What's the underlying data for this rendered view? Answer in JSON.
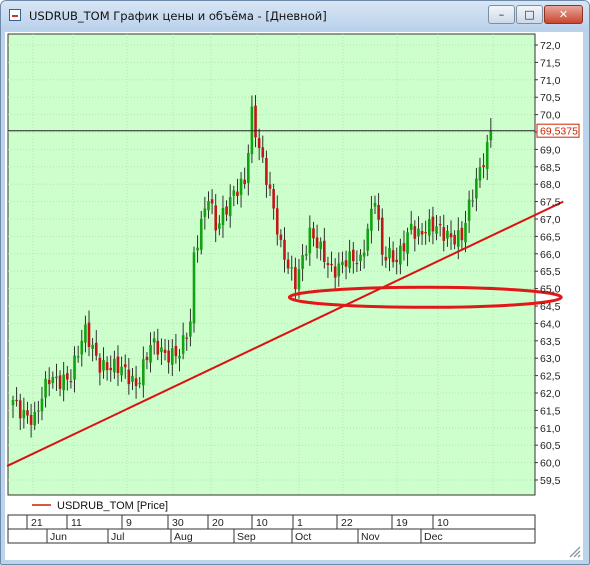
{
  "window": {
    "title": "USDRUB_TOM График цены и объёма - [Дневной]",
    "minimize_label": "–",
    "maximize_label": "□",
    "close_label": "✕",
    "icon": "app-icon"
  },
  "legend": {
    "label": "USDRUB_TOM [Price]",
    "color": "#cc2200"
  },
  "current_price": "69,5375",
  "colors": {
    "plot_bg": "#ccffcc",
    "up": "#11a111",
    "down": "#c01818",
    "trend": "#dd1111",
    "highlight": "#e21818"
  },
  "chart_data": {
    "type": "candlestick",
    "series": [
      {
        "name": "USDRUB_TOM [Price]"
      }
    ],
    "y_ticks": [
      "72,0",
      "71,5",
      "71,0",
      "70,5",
      "70,0",
      "69,5",
      "69,0",
      "68,5",
      "68,0",
      "67,5",
      "67,0",
      "66,5",
      "66,0",
      "65,5",
      "65,0",
      "64,5",
      "64,0",
      "63,5",
      "63,0",
      "62,5",
      "62,0",
      "61,5",
      "61,0",
      "60,5",
      "60,0",
      "59,5"
    ],
    "ylim": [
      59.2,
      72.3
    ],
    "x_day_ticks": [
      "21",
      "11",
      "9",
      "30",
      "20",
      "10",
      "1",
      "22",
      "19",
      "10"
    ],
    "x_month_ticks": [
      "Jun",
      "Jul",
      "Aug",
      "Sep",
      "Oct",
      "Nov",
      "Dec"
    ],
    "last_price": 69.5375,
    "horizontal_line": 69.5375,
    "trend_line": [
      {
        "x": 0,
        "y": 59.9
      },
      {
        "x": 152,
        "y": 67.5
      }
    ],
    "highlight_zone": {
      "x_from": 78,
      "x_to": 152,
      "y": 64.75
    },
    "anchors": [
      [
        0,
        61.8
      ],
      [
        6,
        61.2
      ],
      [
        10,
        62.4
      ],
      [
        16,
        62.5
      ],
      [
        20,
        63.7
      ],
      [
        24,
        62.9
      ],
      [
        30,
        62.6
      ],
      [
        34,
        62.3
      ],
      [
        38,
        63.4
      ],
      [
        42,
        63.0
      ],
      [
        46,
        63.3
      ],
      [
        49,
        64.0
      ],
      [
        50,
        65.8
      ],
      [
        54,
        67.7
      ],
      [
        56,
        66.9
      ],
      [
        60,
        67.5
      ],
      [
        64,
        68.0
      ],
      [
        66,
        70.1
      ],
      [
        70,
        68.2
      ],
      [
        74,
        66.1
      ],
      [
        78,
        65.3
      ],
      [
        82,
        66.5
      ],
      [
        84,
        66.2
      ],
      [
        88,
        65.6
      ],
      [
        92,
        65.8
      ],
      [
        96,
        65.7
      ],
      [
        100,
        67.8
      ],
      [
        102,
        66.0
      ],
      [
        106,
        65.7
      ],
      [
        110,
        66.9
      ],
      [
        112,
        66.6
      ],
      [
        116,
        66.7
      ],
      [
        120,
        66.6
      ],
      [
        124,
        66.5
      ],
      [
        128,
        68.0
      ],
      [
        132,
        69.5
      ]
    ]
  }
}
